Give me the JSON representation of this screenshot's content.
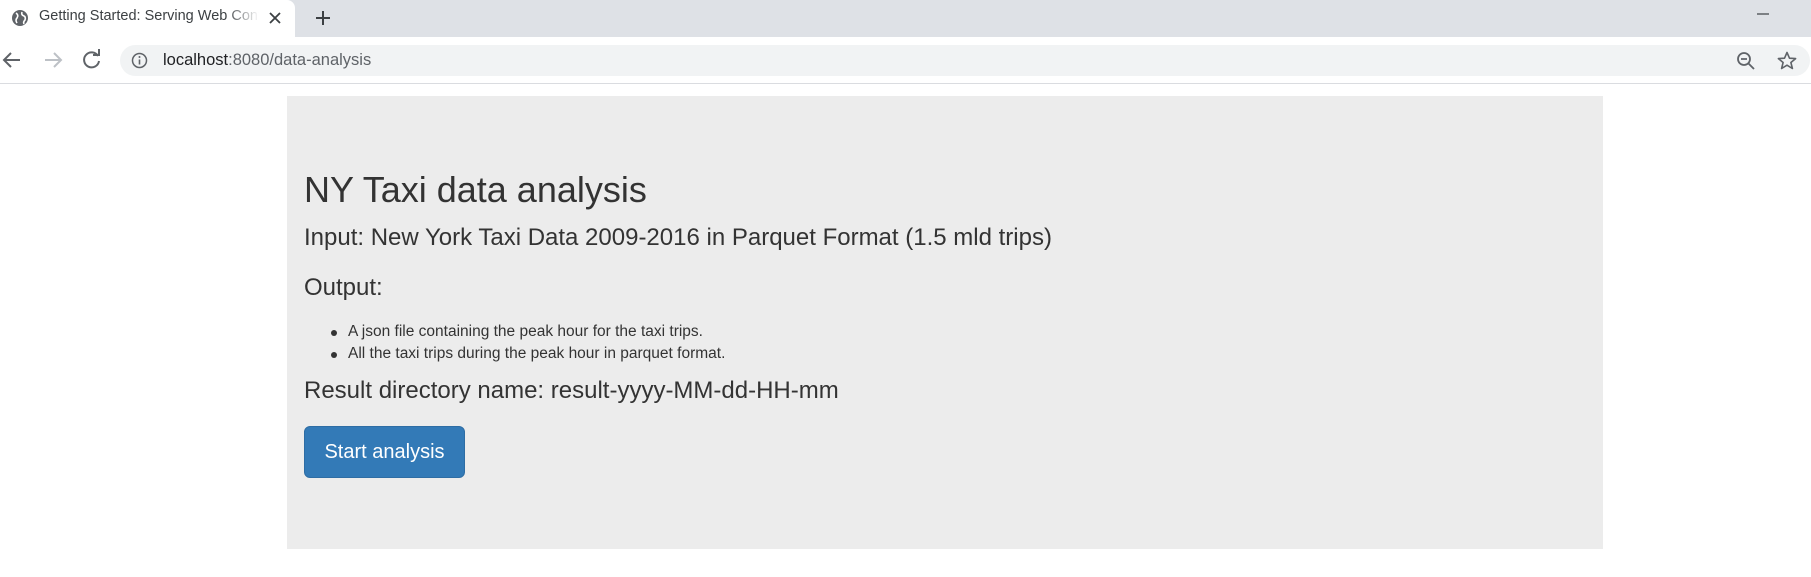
{
  "browser": {
    "tab": {
      "title": "Getting Started: Serving Web Content",
      "favicon_icon": "globe-icon",
      "close_icon": "close-icon"
    },
    "new_tab_icon": "plus-icon",
    "minimize_icon": "minimize-icon",
    "nav": {
      "back_icon": "arrow-left-icon",
      "forward_icon": "arrow-right-icon",
      "reload_icon": "reload-icon"
    },
    "address": {
      "host": "localhost",
      "path": ":8080/data-analysis",
      "info_icon": "info-icon",
      "zoom_icon": "zoom-out-icon",
      "bookmark_icon": "star-icon"
    }
  },
  "page": {
    "title": "NY Taxi data analysis",
    "input_line": "Input: New York Taxi Data 2009-2016 in Parquet Format (1.5 mld trips)",
    "output_heading": "Output:",
    "output_items": [
      "A json file containing the peak hour for the taxi trips.",
      "All the taxi trips during the peak hour in parquet format."
    ],
    "result_line": "Result directory name: result-yyyy-MM-dd-HH-mm",
    "start_button_label": "Start analysis"
  },
  "colors": {
    "tabstrip": "#dee1e6",
    "omnibox": "#f1f3f4",
    "jumbotron": "#ececec",
    "text": "#333333",
    "button": "#337ab7"
  }
}
